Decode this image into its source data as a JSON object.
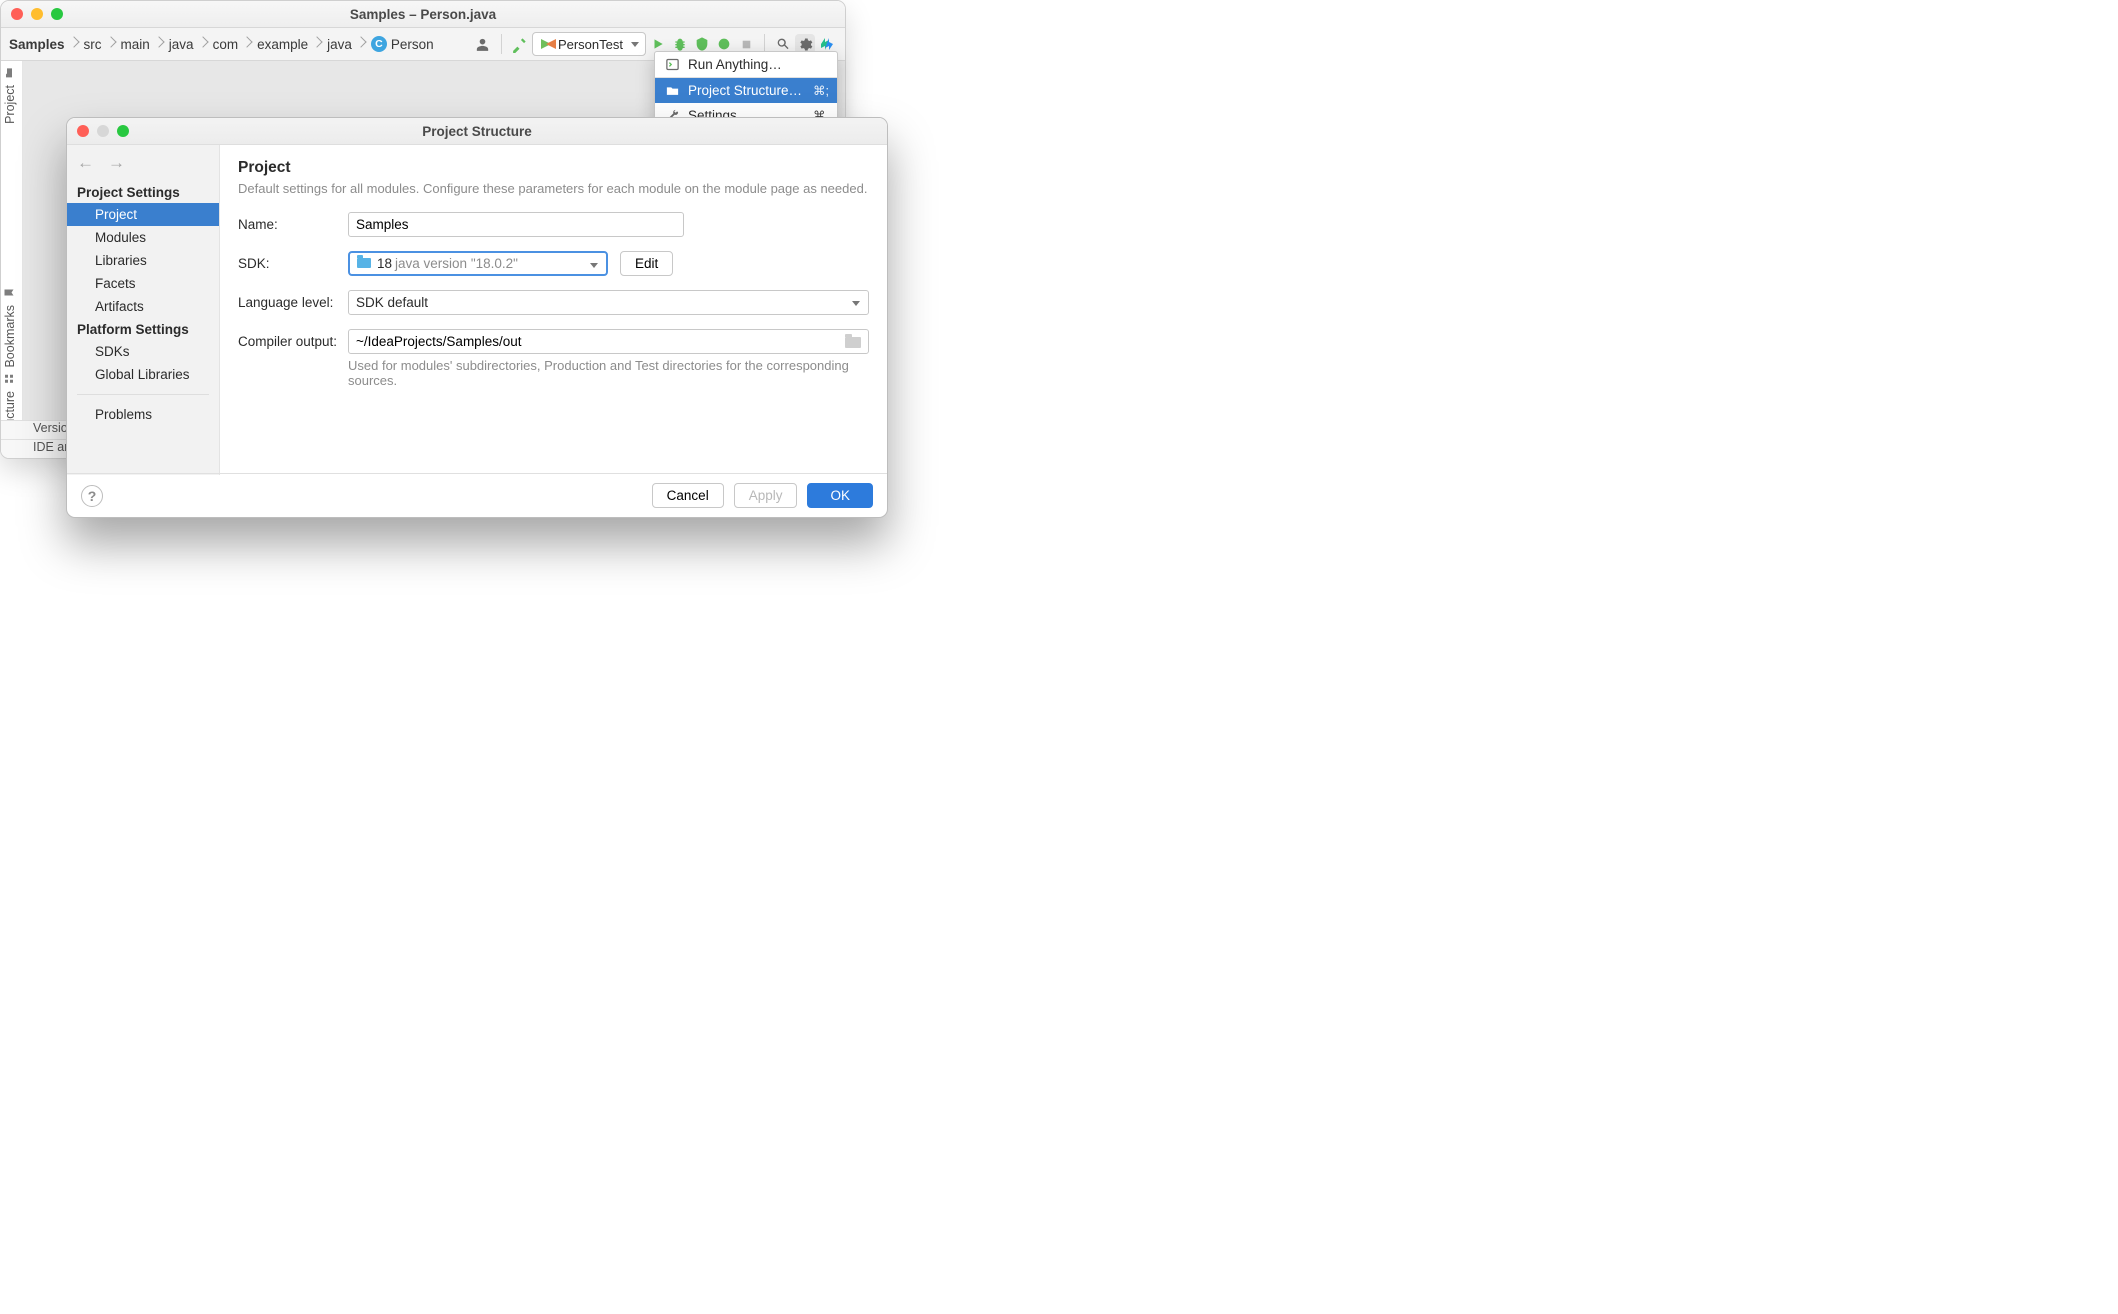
{
  "window": {
    "title": "Samples – Person.java"
  },
  "breadcrumb": [
    "Samples",
    "src",
    "main",
    "java",
    "com",
    "example",
    "java",
    "Person"
  ],
  "run_config": {
    "label": "PersonTest"
  },
  "left_tabs": {
    "project": "Project",
    "bookmarks": "Bookmarks",
    "structure": "Structure"
  },
  "status": {
    "top": "Version",
    "bottom": "IDE an"
  },
  "settings_menu": {
    "run_anything": "Run Anything…",
    "project_structure": "Project Structure…",
    "project_structure_short": "⌘;",
    "settings": "Settings…",
    "settings_short": "⌘,"
  },
  "dialog": {
    "title": "Project Structure",
    "side": {
      "project_settings": "Project Settings",
      "items1": [
        "Project",
        "Modules",
        "Libraries",
        "Facets",
        "Artifacts"
      ],
      "platform_settings": "Platform Settings",
      "items2": [
        "SDKs",
        "Global Libraries"
      ],
      "problems": "Problems"
    },
    "main": {
      "heading": "Project",
      "desc": "Default settings for all modules. Configure these parameters for each module on the module page as needed.",
      "labels": {
        "name": "Name:",
        "sdk": "SDK:",
        "lang": "Language level:",
        "out": "Compiler output:"
      },
      "name_value": "Samples",
      "sdk_value": "18",
      "sdk_version": "java version \"18.0.2\"",
      "edit_btn": "Edit",
      "lang_value": "SDK default",
      "out_value": "~/IdeaProjects/Samples/out",
      "out_hint": "Used for modules' subdirectories, Production and Test directories for the corresponding sources."
    },
    "footer": {
      "cancel": "Cancel",
      "apply": "Apply",
      "ok": "OK"
    }
  }
}
